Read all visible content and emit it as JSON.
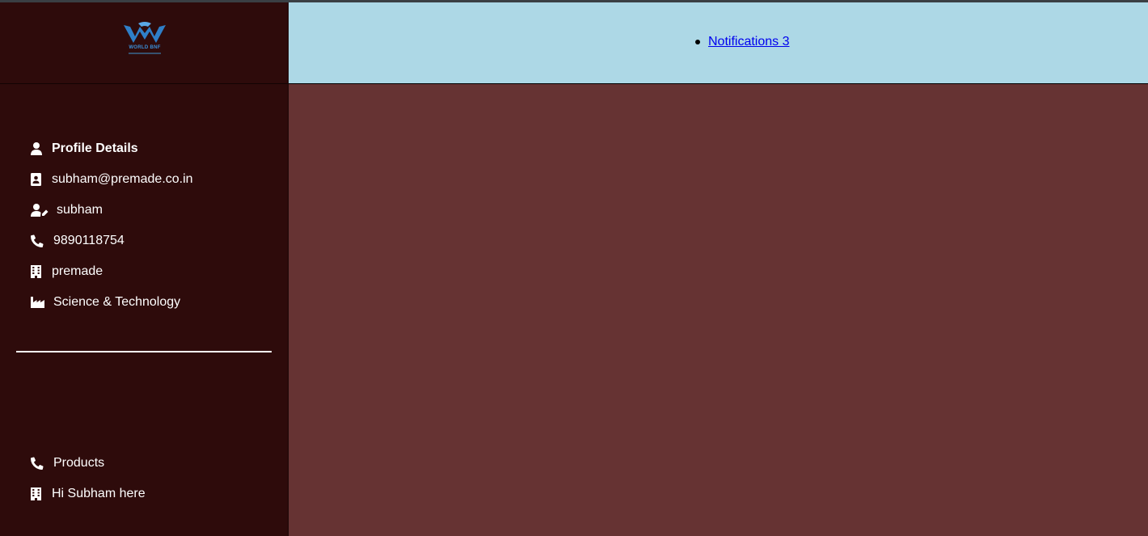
{
  "logo": {
    "text": "WORLD BNF",
    "brand_color": "#3a8fd9"
  },
  "profile": {
    "heading": "Profile Details",
    "email": "subham@premade.co.in",
    "username": "subham",
    "phone": "9890118754",
    "company": "premade",
    "industry": "Science & Technology"
  },
  "nav": {
    "products": "Products",
    "greeting": "Hi Subham here"
  },
  "header": {
    "notifications_label": "Notifications 3"
  },
  "colors": {
    "sidebar_bg": "#2e0b0b",
    "header_bg": "#add8e6",
    "main_bg": "#663333",
    "link": "#0000ee"
  },
  "icons": {
    "profile": "user-icon",
    "email": "id-card-icon",
    "username": "user-edit-icon",
    "phone": "phone-icon",
    "company": "building-icon",
    "industry": "industry-icon",
    "products": "phone-icon",
    "greeting": "building-icon"
  }
}
